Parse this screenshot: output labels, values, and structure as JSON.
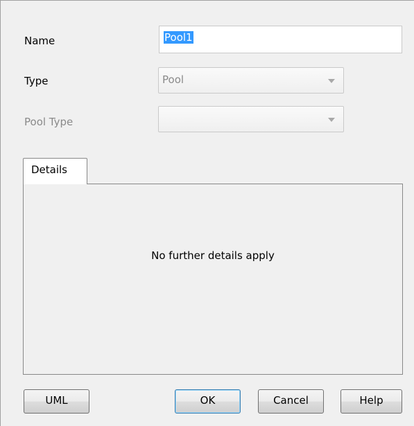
{
  "form": {
    "name_label": "Name",
    "name_value": "Pool1",
    "type_label": "Type",
    "type_value": "Pool",
    "pool_type_label": "Pool Type",
    "pool_type_value": ""
  },
  "tabs": {
    "details_label": "Details",
    "details_message": "No further details apply"
  },
  "buttons": {
    "uml": "UML",
    "ok": "OK",
    "cancel": "Cancel",
    "help": "Help"
  },
  "icons": {
    "dropdown": "chevron-down-icon"
  },
  "colors": {
    "selection": "#3399ff",
    "disabled_text": "#8a8a8a",
    "background": "#f0f0f0"
  }
}
